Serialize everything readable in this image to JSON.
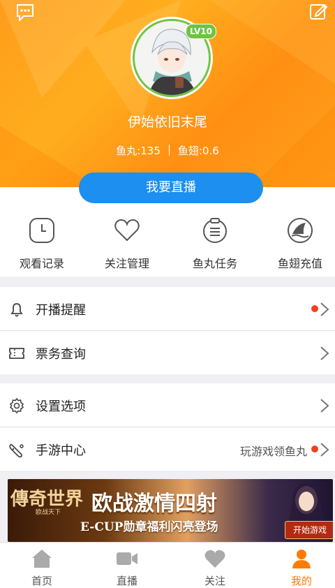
{
  "header": {
    "level": "LV10",
    "username": "伊始依旧末尾",
    "fish_balls": "鱼丸:135",
    "fish_fins": "鱼翅:0.6",
    "live_button": "我要直播"
  },
  "quick_actions": [
    {
      "label": "观看记录",
      "icon": "clock-icon"
    },
    {
      "label": "关注管理",
      "icon": "heart-icon"
    },
    {
      "label": "鱼丸任务",
      "icon": "task-list-icon"
    },
    {
      "label": "鱼翅充值",
      "icon": "shark-fin-icon"
    }
  ],
  "menu_group_1": [
    {
      "label": "开播提醒",
      "icon": "bell-icon",
      "dot": true
    },
    {
      "label": "票务查询",
      "icon": "ticket-icon",
      "dot": false
    }
  ],
  "menu_group_2": [
    {
      "label": "设置选项",
      "icon": "gear-icon",
      "dot": false
    },
    {
      "label": "手游中心",
      "icon": "gamepad-icon",
      "extra": "玩游戏领鱼丸",
      "dot": true
    }
  ],
  "banner": {
    "logo": "傳奇世界",
    "logo_sub": "欧战天下",
    "title": "欧战激情四射",
    "subtitle": "E-CUP勋章福利闪亮登场",
    "button": "开始游戏"
  },
  "tabbar": [
    {
      "label": "首页",
      "icon": "home-icon",
      "active": false
    },
    {
      "label": "直播",
      "icon": "video-camera-icon",
      "active": false
    },
    {
      "label": "关注",
      "icon": "heart-icon",
      "active": false
    },
    {
      "label": "我的",
      "icon": "user-icon",
      "active": true
    }
  ],
  "colors": {
    "header_orange": "#ff9c1a",
    "live_button_blue": "#1c8ff0",
    "level_green": "#6fc43f",
    "active_tab": "#ff7a00",
    "notification_dot": "#f0421d"
  }
}
